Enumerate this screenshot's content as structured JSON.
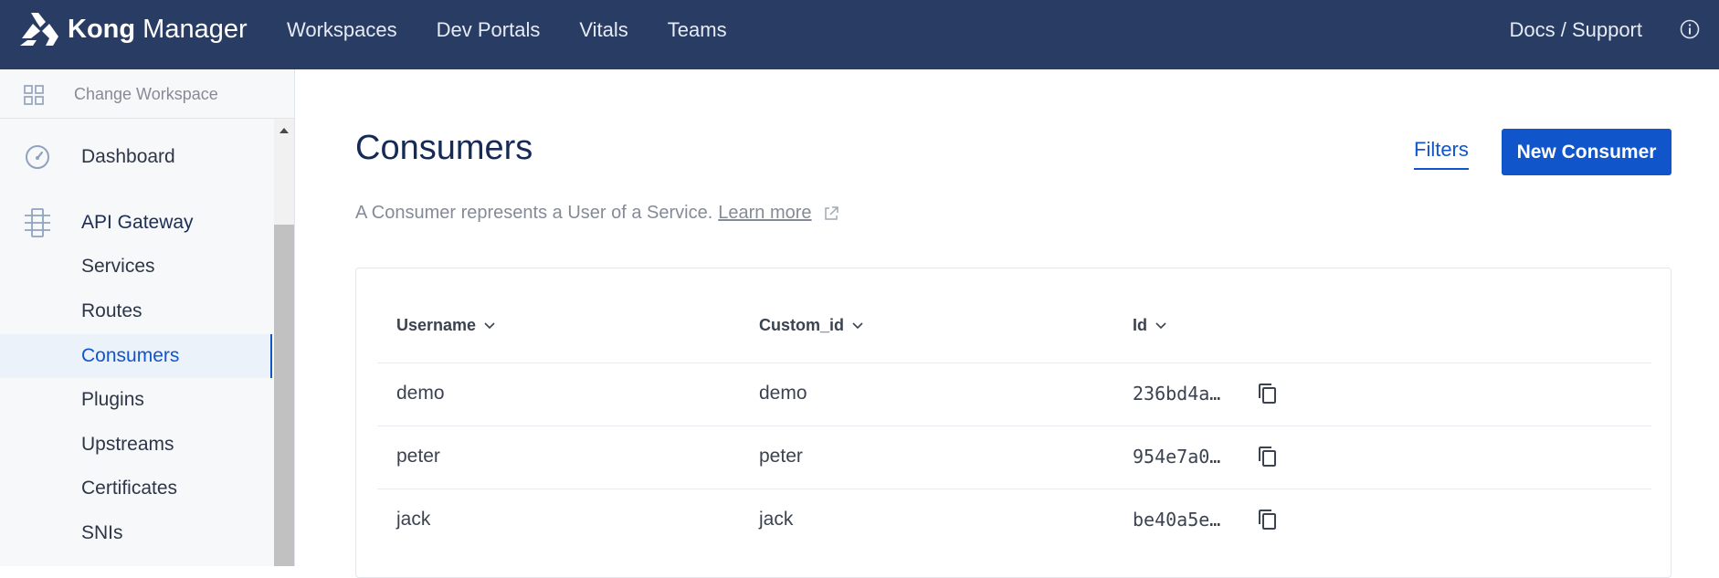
{
  "app": {
    "brand_bold": "Kong",
    "brand_light": "Manager",
    "nav": [
      "Workspaces",
      "Dev Portals",
      "Vitals",
      "Teams"
    ],
    "docs_support": "Docs / Support"
  },
  "sidebar": {
    "change_workspace": "Change Workspace",
    "dashboard": "Dashboard",
    "section": "API Gateway",
    "items": [
      "Services",
      "Routes",
      "Consumers",
      "Plugins",
      "Upstreams",
      "Certificates",
      "SNIs"
    ],
    "active": "Consumers"
  },
  "main": {
    "title": "Consumers",
    "filters_label": "Filters",
    "new_button": "New Consumer",
    "description": "A Consumer represents a User of a Service.",
    "learn_more": "Learn more"
  },
  "table": {
    "columns": [
      "Username",
      "Custom_id",
      "Id"
    ],
    "rows": [
      {
        "username": "demo",
        "custom_id": "demo",
        "id": "236bd4a…"
      },
      {
        "username": "peter",
        "custom_id": "peter",
        "id": "954e7a0…"
      },
      {
        "username": "jack",
        "custom_id": "jack",
        "id": "be40a5e…"
      }
    ]
  },
  "colors": {
    "topbar": "#293c63",
    "accent": "#1155cb",
    "title": "#152a57"
  }
}
